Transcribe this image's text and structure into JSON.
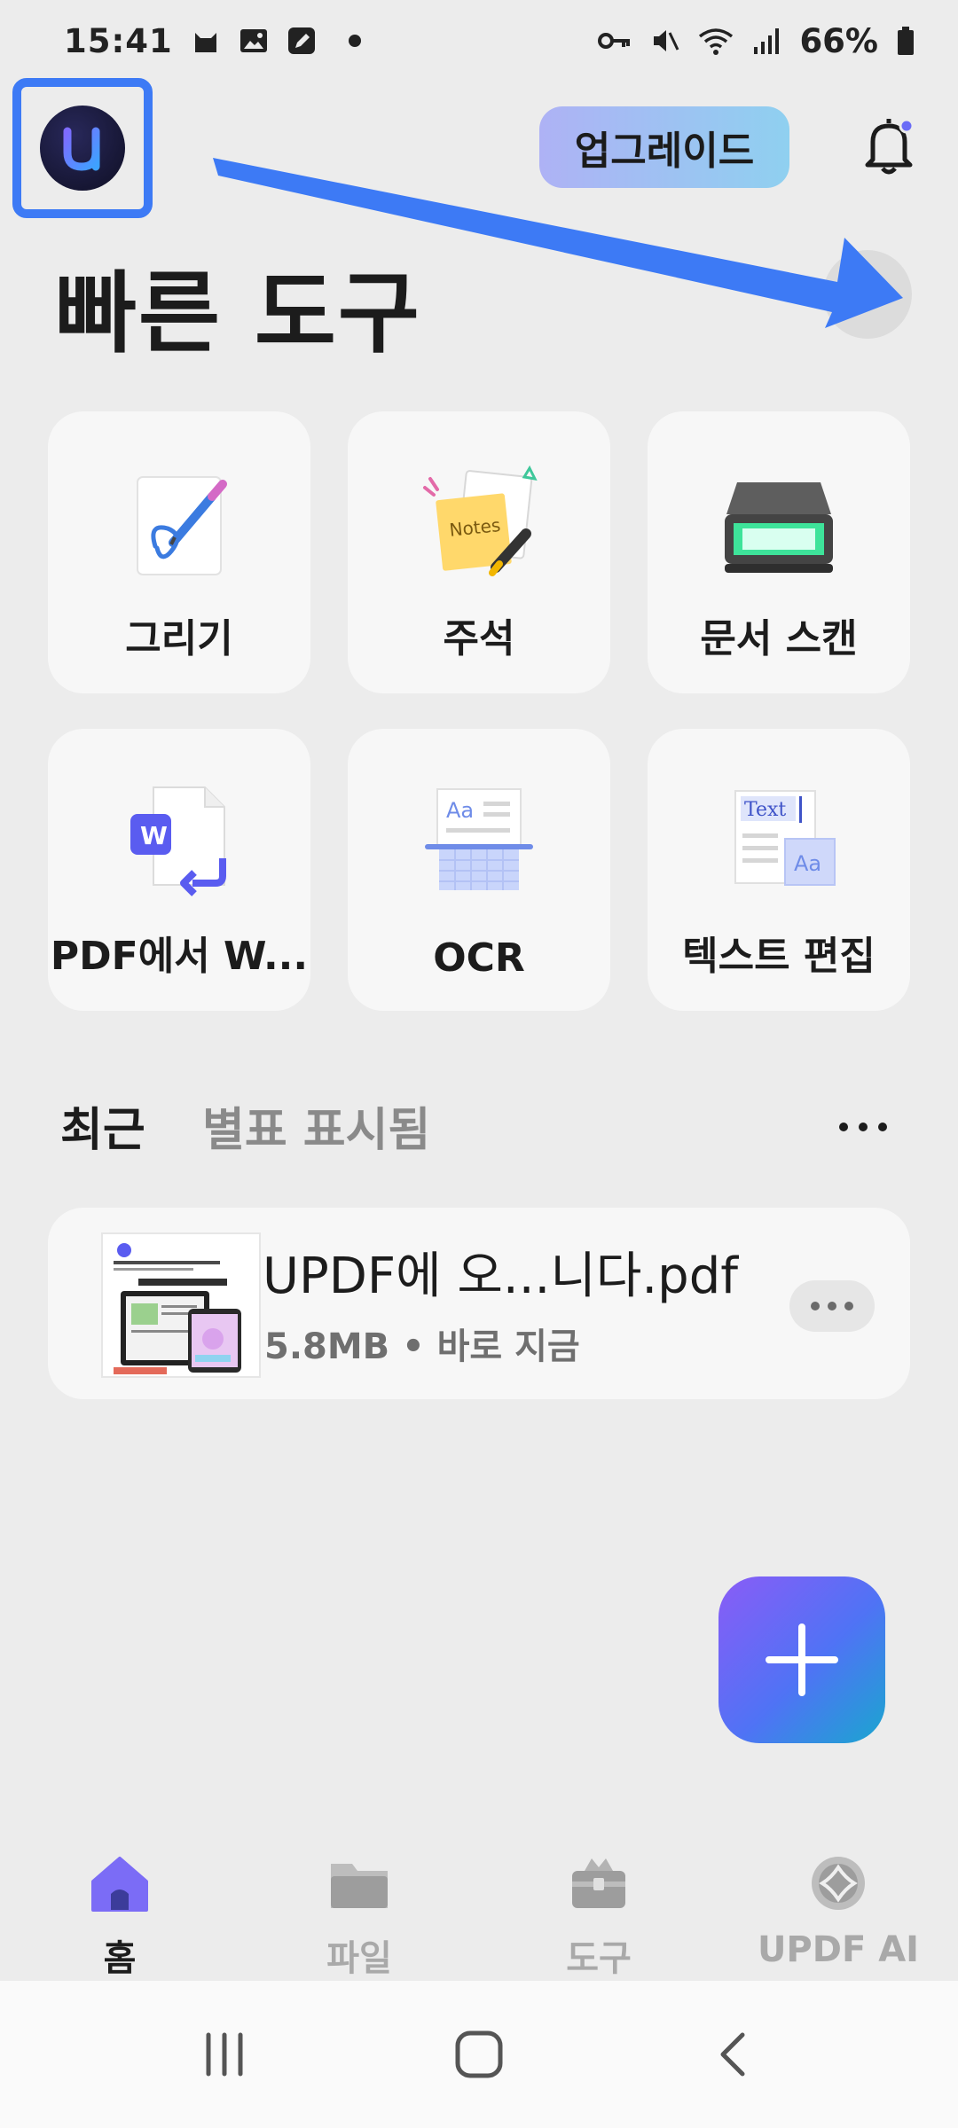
{
  "status_bar": {
    "time": "15:41",
    "battery": "66%",
    "icons": [
      "cat-icon",
      "gallery-icon",
      "edit-icon",
      "dot-icon",
      "key-icon",
      "mute-icon",
      "wifi-icon",
      "signal-icon",
      "battery-icon"
    ]
  },
  "header": {
    "upgrade_label": "업그레이드",
    "title": "빠른 도구"
  },
  "tools": [
    {
      "label": "그리기",
      "icon": "draw-icon"
    },
    {
      "label": "주석",
      "icon": "notes-icon"
    },
    {
      "label": "문서 스캔",
      "icon": "scanner-icon"
    },
    {
      "label": "PDF에서 W...",
      "icon": "pdf-to-word-icon"
    },
    {
      "label": "OCR",
      "icon": "ocr-icon"
    },
    {
      "label": "텍스트 편집",
      "icon": "text-edit-icon"
    }
  ],
  "tool_art": {
    "notes_text": "Notes",
    "ocr_text": "Aa",
    "word_letter": "W",
    "text_edit_text": "Text",
    "text_edit_aa": "Aa"
  },
  "recent": {
    "tab_recent": "최근",
    "tab_starred": "별표 표시됨",
    "files": [
      {
        "name": "UPDF에 오...니다.pdf",
        "meta": "5.8MB • 바로 지금"
      }
    ]
  },
  "bottom_nav": {
    "items": [
      {
        "label": "홈",
        "active": true,
        "icon": "home-icon"
      },
      {
        "label": "파일",
        "active": false,
        "icon": "folder-icon"
      },
      {
        "label": "도구",
        "active": false,
        "icon": "toolbox-icon"
      },
      {
        "label": "UPDF AI",
        "active": false,
        "icon": "ai-icon"
      }
    ]
  },
  "colors": {
    "accent": "#3d7af5",
    "active_nav": "#7b6cf6",
    "background": "#ececec",
    "card": "#f7f7f7"
  }
}
